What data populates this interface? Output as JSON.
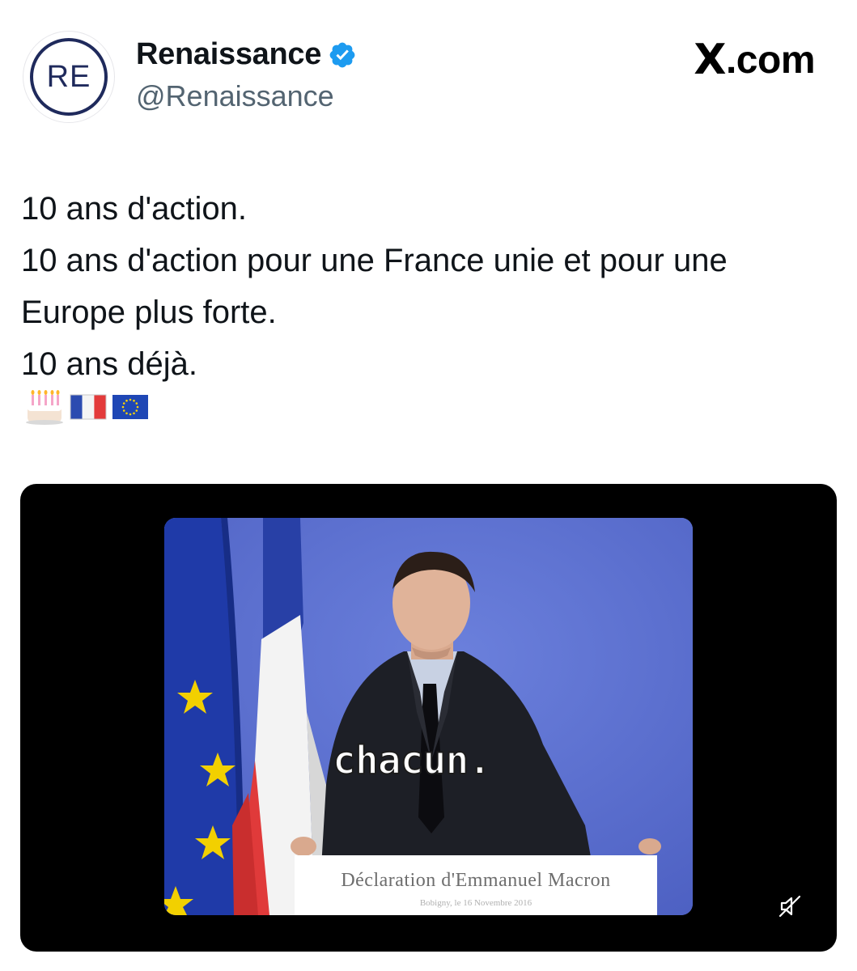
{
  "account": {
    "avatar_text": "RE",
    "display_name": "Renaissance",
    "handle": "@Renaissance",
    "verified": true
  },
  "source": {
    "label": ".com",
    "logo": "X"
  },
  "tweet": {
    "lines": [
      "10 ans d'action.",
      "10 ans d'action pour une France unie et pour une",
      "Europe plus forte.",
      "10 ans déjà."
    ],
    "emojis": [
      "birthday-cake",
      "france-flag",
      "eu-flag"
    ]
  },
  "video": {
    "caption": "chacun.",
    "podium_title": "Déclaration d'Emmanuel Macron",
    "podium_subtitle": "Bobigny, le 16 Novembre 2016",
    "muted": true
  },
  "colors": {
    "verified_blue": "#1d9bf0",
    "brand_navy": "#1f2a5c",
    "handle_gray": "#536471",
    "backdrop_blue": "#5f74d3"
  }
}
